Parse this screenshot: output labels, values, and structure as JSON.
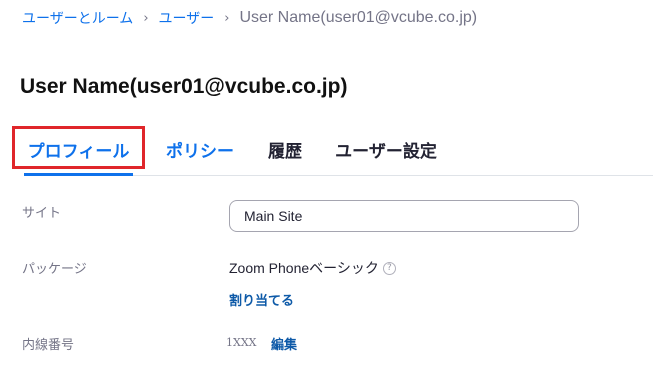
{
  "breadcrumb": {
    "items": [
      "ユーザーとルーム",
      "ユーザー"
    ],
    "separator": "›",
    "current": "User Name(user01@vcube.co.jp)"
  },
  "page": {
    "title": "User Name(user01@vcube.co.jp)"
  },
  "tabs": [
    {
      "label": "プロフィール",
      "active": true
    },
    {
      "label": "ポリシー",
      "active": false
    },
    {
      "label": "履歴",
      "active": false
    },
    {
      "label": "ユーザー設定",
      "active": false
    }
  ],
  "fields": {
    "site": {
      "label": "サイト",
      "value": "Main Site"
    },
    "package": {
      "label": "パッケージ",
      "value": "Zoom Phoneベーシック",
      "help_icon": "?",
      "link": "割り当てる"
    },
    "extension": {
      "label": "内線番号",
      "value": "1XXX",
      "link": "編集"
    }
  },
  "colors": {
    "accent": "#0E71EB",
    "link_dark": "#0E5AA8",
    "highlight_box": "#e0262a",
    "muted_text": "#747487"
  }
}
